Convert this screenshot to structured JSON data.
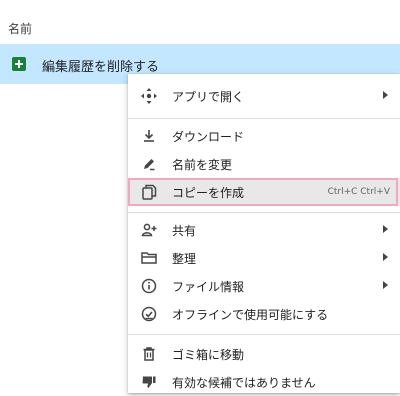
{
  "list_header": {
    "name_label": "名前"
  },
  "file": {
    "name": "編集履歴を削除する",
    "icon": "sheets-icon",
    "icon_color": "#188038",
    "selected_bg": "#c2e7ff"
  },
  "menu": {
    "open_with": {
      "label": "アプリで開く",
      "icon": "open-with-icon"
    },
    "download": {
      "label": "ダウンロード",
      "icon": "download-icon"
    },
    "rename": {
      "label": "名前を変更",
      "icon": "pencil-icon"
    },
    "make_copy": {
      "label": "コピーを作成",
      "icon": "copy-icon",
      "shortcut": "Ctrl+C Ctrl+V",
      "highlight_color": "#f3a6c4"
    },
    "share": {
      "label": "共有",
      "icon": "share-person-icon"
    },
    "organize": {
      "label": "整理",
      "icon": "folder-icon"
    },
    "file_info": {
      "label": "ファイル情報",
      "icon": "info-icon"
    },
    "offline": {
      "label": "オフラインで使用可能にする",
      "icon": "offline-check-icon"
    },
    "trash": {
      "label": "ゴミ箱に移動",
      "icon": "trash-icon"
    },
    "report": {
      "label": "有効な候補ではありません",
      "icon": "thumb-down-icon"
    }
  }
}
